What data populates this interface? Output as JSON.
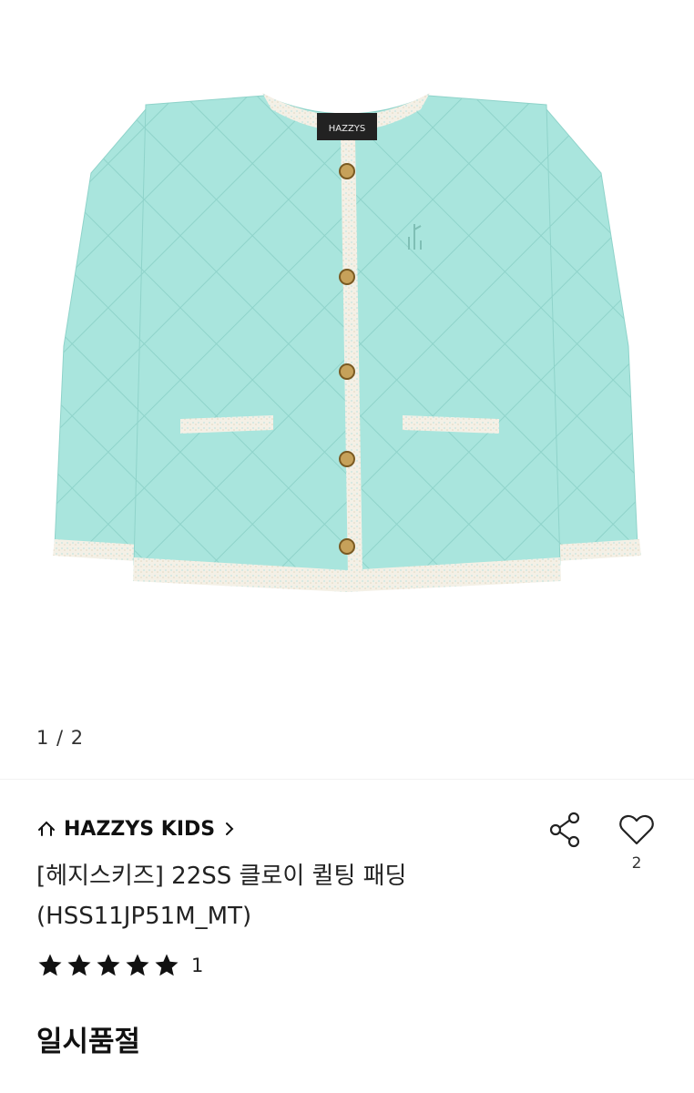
{
  "gallery": {
    "image_alt": "quilted mint jacket with tweed trim",
    "label_text": "HAZZYS",
    "page_indicator": "1 / 2"
  },
  "product": {
    "brand": "HAZZYS KIDS",
    "title_line1": "[헤지스키즈] 22SS 클로이 퀼팅 패딩",
    "title_line2": "(HSS11JP51M_MT)",
    "rating_stars": 5,
    "review_count": "1",
    "status": "일시품절"
  },
  "actions": {
    "like_count": "2"
  },
  "colors": {
    "jacket": "#a6e4dc",
    "trim": "#f3efe6",
    "button": "#c6a15a",
    "star": "#111111"
  },
  "icons": [
    "home-icon",
    "chevron-right-icon",
    "share-icon",
    "heart-icon",
    "star-icon"
  ]
}
